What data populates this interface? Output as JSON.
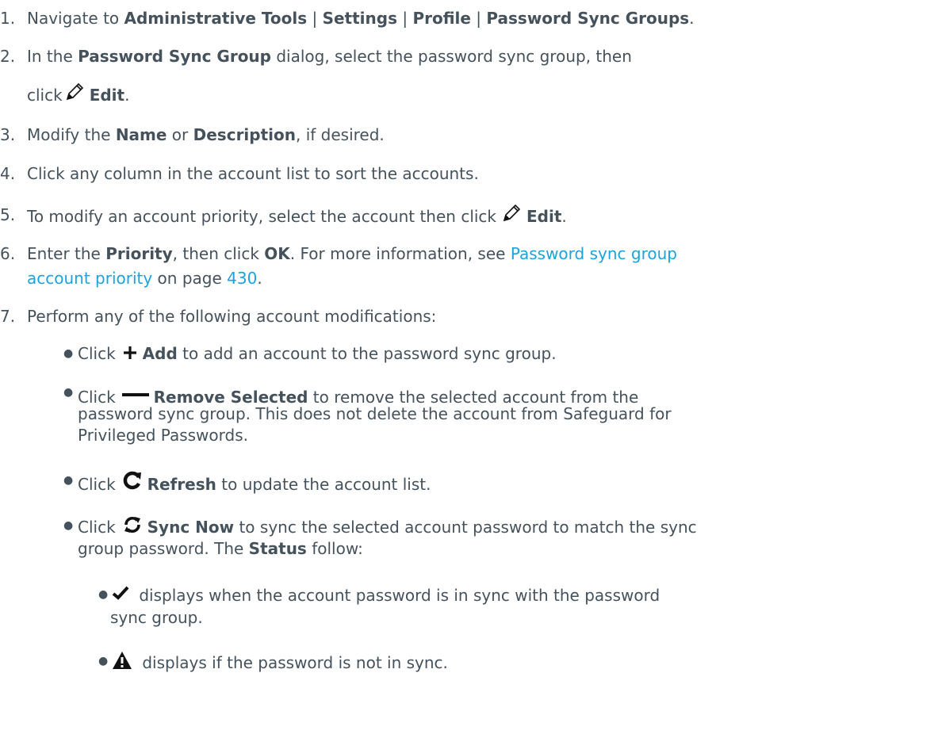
{
  "steps": [
    {
      "num": "1.",
      "t1": "Navigate to ",
      "b1": "Administrative Tools",
      "sep1": " | ",
      "b2": "Settings",
      "sep2": " | ",
      "b3": "Profile",
      "sep3": " | ",
      "b4": "Password Sync Groups",
      "t2": "."
    },
    {
      "num": "2.",
      "t1": "In the ",
      "b1": "Password Sync Group",
      "t2": " dialog, select the password sync group, then",
      "t3": "click",
      "icon": "pencil-icon",
      "b2": "Edit",
      "t4": "."
    },
    {
      "num": "3.",
      "t1": "Modify the ",
      "b1": "Name",
      "t2": " or ",
      "b2": "Description",
      "t3": ", if desired."
    },
    {
      "num": "4.",
      "t1": "Click any column in the account list to sort the accounts."
    },
    {
      "num": "5.",
      "t1": "To modify an account priority, select the account then click",
      "icon": "pencil-icon",
      "b1": "Edit",
      "t2": "."
    },
    {
      "num": "6.",
      "t1": "Enter the ",
      "b1": "Priority",
      "t2": ", then click ",
      "b2": "OK",
      "t3": ". For more information, see ",
      "link1": "Password sync group",
      "link2": "account priority",
      "t4": " on page ",
      "link3": "430",
      "t5": "."
    },
    {
      "num": "7.",
      "t1": "Perform any of the following account modifications:"
    }
  ],
  "sub_items": [
    {
      "t1": "Click",
      "icon": "plus-icon",
      "b1": "Add",
      "t2": " to add an account to the password sync group."
    },
    {
      "t1": "Click",
      "icon": "minus-icon",
      "b1": "Remove Selected",
      "t2": " to remove the selected account from the",
      "line2": "password sync group. This does not delete the account from Safeguard for",
      "line3": "Privileged Passwords."
    },
    {
      "t1": "Click",
      "icon": "refresh-icon",
      "b1": "Refresh",
      "t2": " to update the account list."
    },
    {
      "t1": "Click",
      "icon": "sync-icon",
      "b1": "Sync Now",
      "t2": " to sync the selected account password to match the sync",
      "line2a": "group password. The ",
      "b2": "Status",
      "line2b": " follow:"
    }
  ],
  "status_items": [
    {
      "icon": "checkmark-icon",
      "t1": " displays when the account password is in sync with the password",
      "line2": "sync group."
    },
    {
      "icon": "warning-icon",
      "t1": " displays if the password is not in sync."
    }
  ],
  "colors": {
    "text": "#45525c",
    "link": "#1ba3e0"
  }
}
